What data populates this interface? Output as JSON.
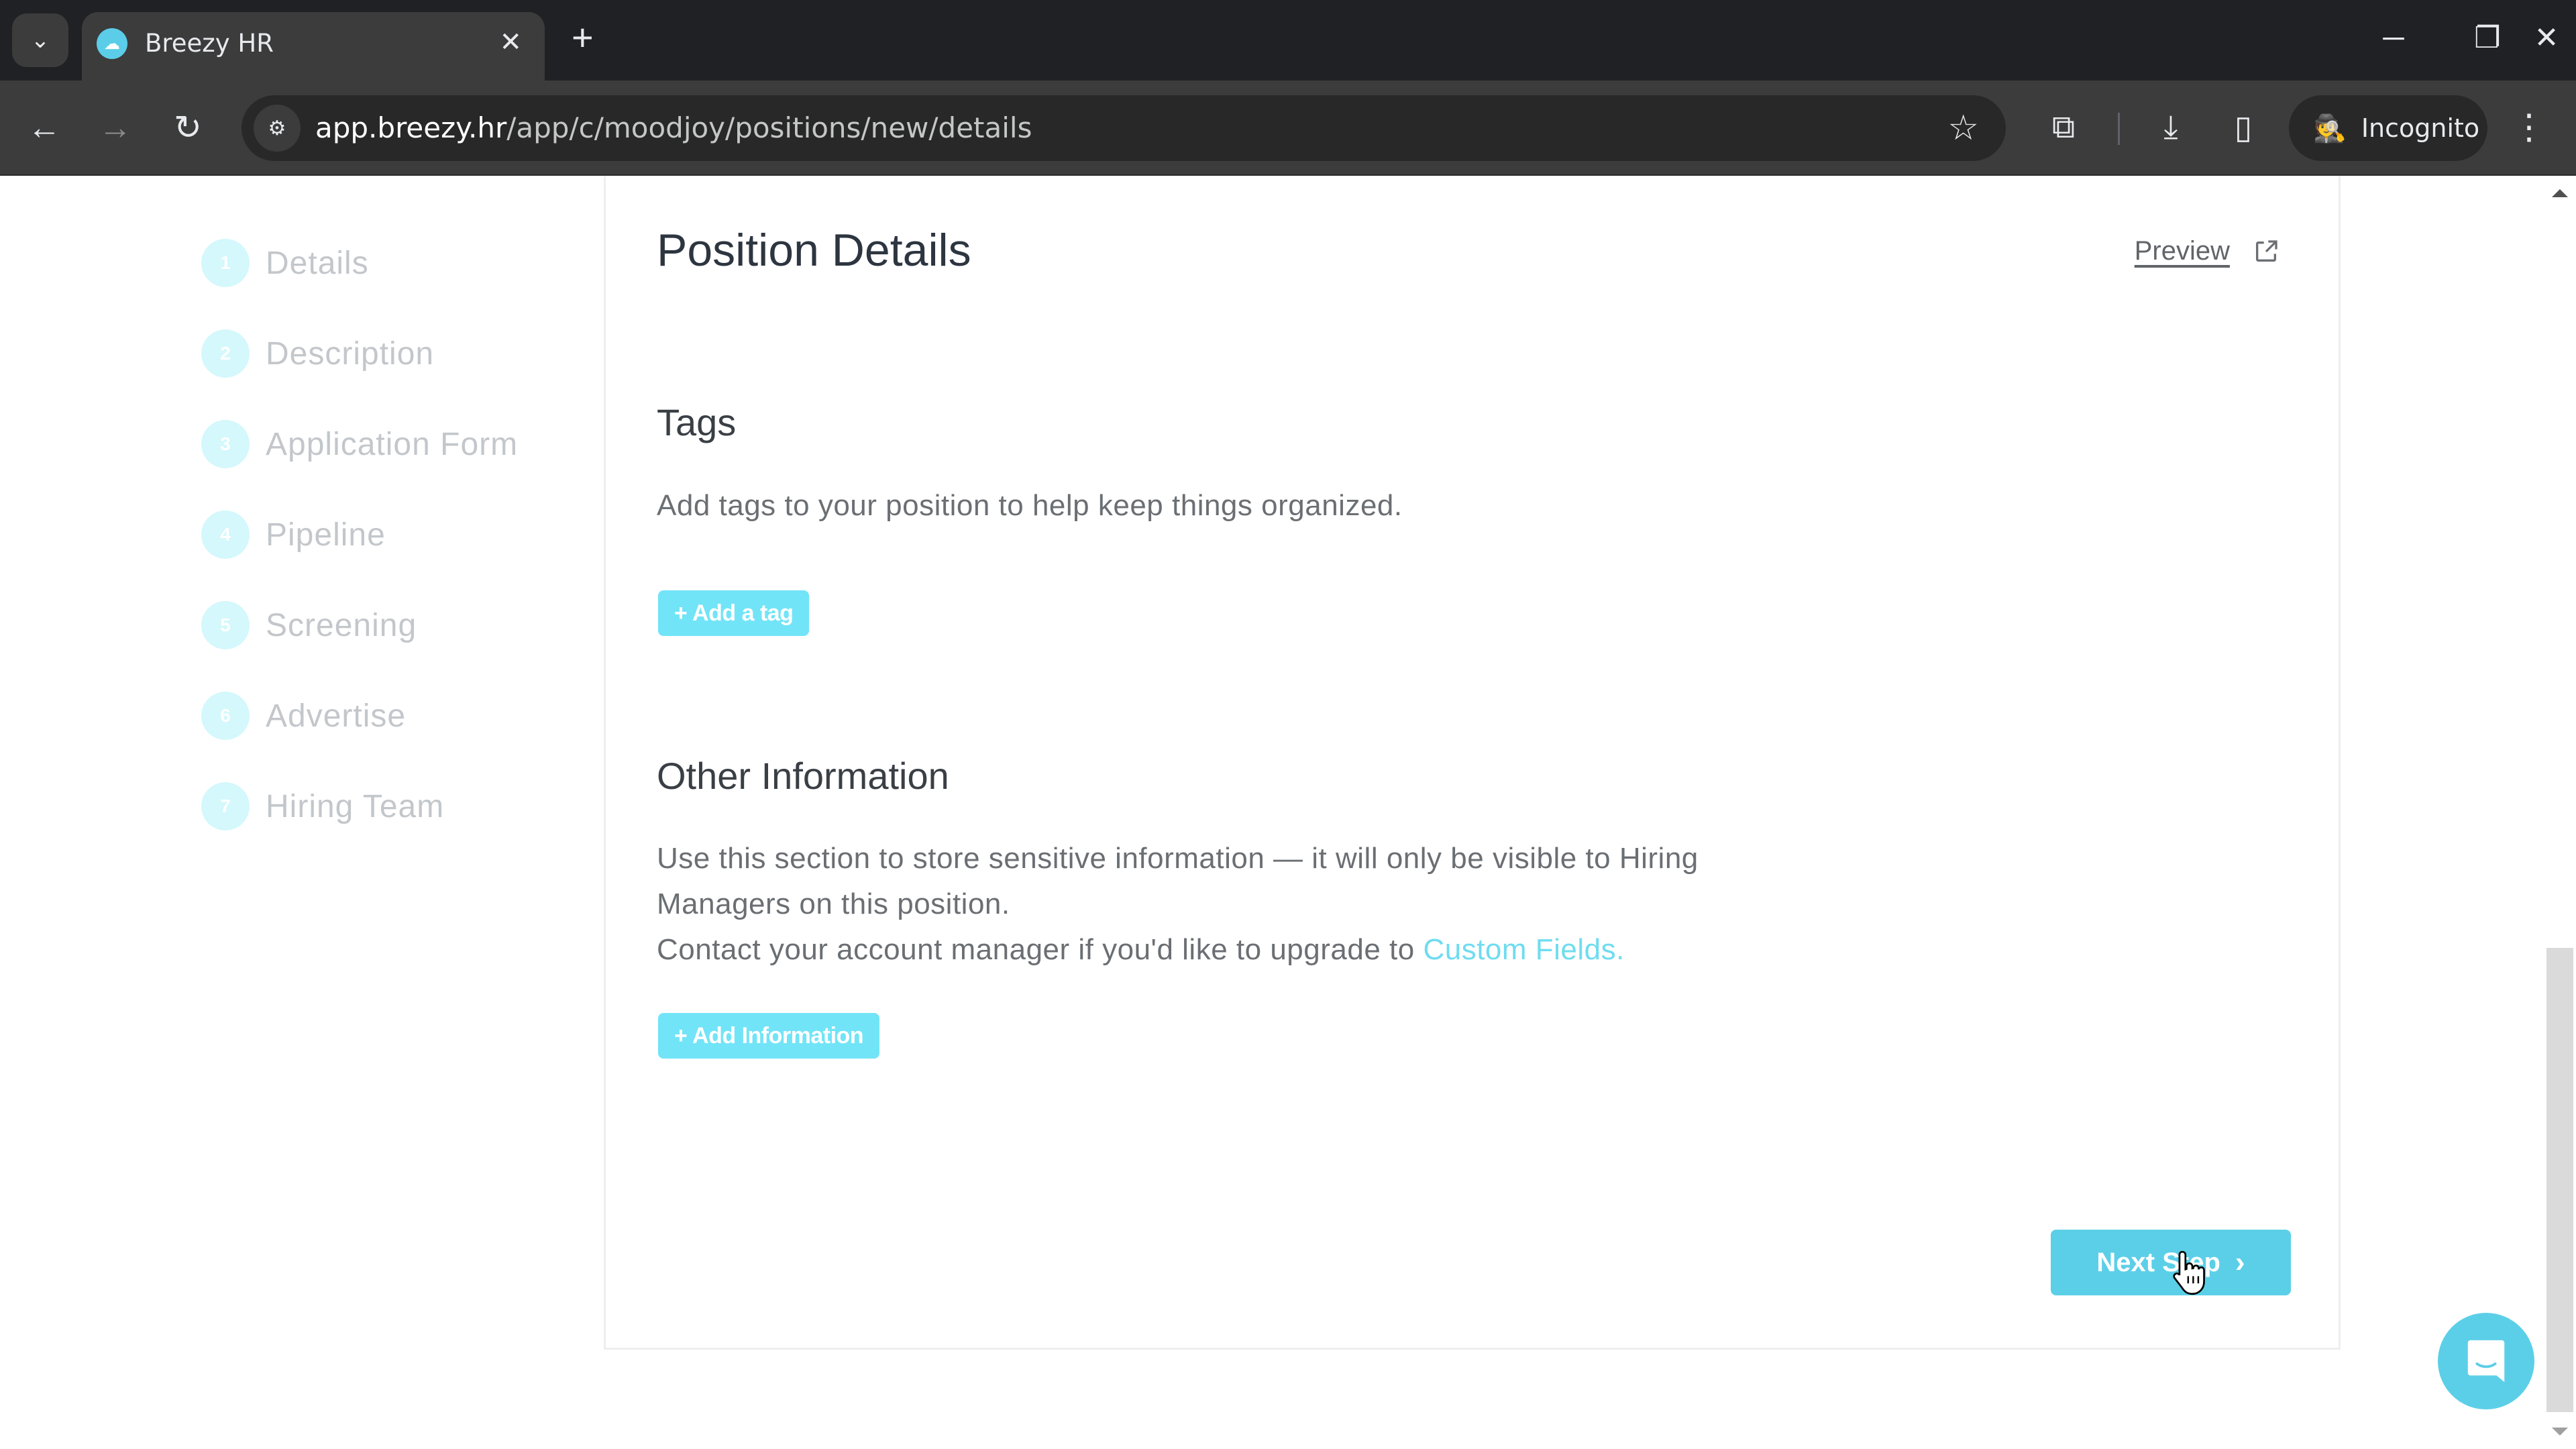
{
  "browser": {
    "tab": {
      "title": "Breezy HR",
      "favicon": "breezy-cloud-icon"
    },
    "url": {
      "host": "app.breezy.hr",
      "path": "/app/c/moodjoy/positions/new/details"
    },
    "incognito_label": "Incognito",
    "icons": {
      "tab_search": "chevron-down-icon",
      "close_tab": "close-icon",
      "new_tab": "plus-icon",
      "back": "arrow-left-icon",
      "forward": "arrow-right-icon",
      "reload": "reload-icon",
      "site_info": "tune-icon",
      "bookmark": "star-icon",
      "extensions": "puzzle-icon",
      "downloads": "download-icon",
      "side_panel": "side-panel-icon",
      "incognito": "incognito-icon",
      "menu": "kebab-menu-icon",
      "minimize": "minimize-icon",
      "restore": "restore-icon",
      "close_window": "close-icon"
    },
    "glyphs": {
      "tab_search": "⌄",
      "close_tab": "✕",
      "new_tab": "+",
      "back": "←",
      "forward": "→",
      "reload": "↻",
      "site_info": "⚙",
      "bookmark": "☆",
      "extensions": "⧉",
      "downloads": "⤓",
      "side_panel": "▯",
      "incognito": "🕵",
      "menu": "⋮",
      "minimize": "─",
      "restore": "❐",
      "close_window": "✕"
    }
  },
  "sidebar": {
    "steps": [
      {
        "number": "1",
        "label": "Details"
      },
      {
        "number": "2",
        "label": "Description"
      },
      {
        "number": "3",
        "label": "Application Form"
      },
      {
        "number": "4",
        "label": "Pipeline"
      },
      {
        "number": "5",
        "label": "Screening"
      },
      {
        "number": "6",
        "label": "Advertise"
      },
      {
        "number": "7",
        "label": "Hiring Team"
      }
    ]
  },
  "main": {
    "title": "Position Details",
    "preview_label": "Preview",
    "tags": {
      "heading": "Tags",
      "description": "Add tags to your position to help keep things organized.",
      "add_button": "+ Add a tag"
    },
    "other_info": {
      "heading": "Other Information",
      "line1": "Use this section to store sensitive information — it will only be visible to Hiring",
      "line2": "Managers on this position.",
      "line3_prefix": "Contact your account manager if you'd like to upgrade to ",
      "line3_link": "Custom Fields.",
      "add_button": "+ Add Information"
    },
    "next_button": "Next Step",
    "next_chevron": "›"
  },
  "colors": {
    "accent": "#5ccfe8",
    "accent_light": "#72e4f7",
    "step_circle": "#d4f8fb",
    "link": "#6fdcf0",
    "heading": "#2d3540",
    "body_text": "#6b6f73"
  }
}
